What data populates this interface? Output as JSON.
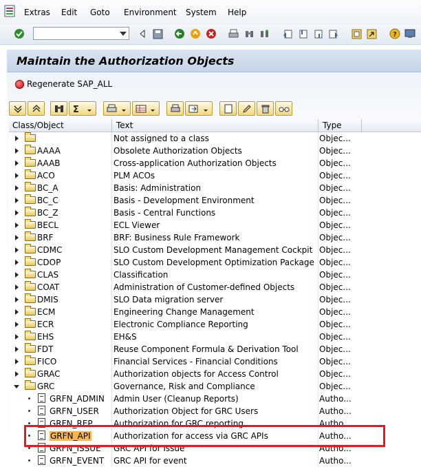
{
  "menu": [
    "Extras",
    "Edit",
    "Goto",
    "Environment",
    "System",
    "Help"
  ],
  "title": "Maintain the Authorization Objects",
  "regenerate_label": "Regenerate SAP_ALL",
  "columns": [
    "Class/Object",
    "Text",
    "Type"
  ],
  "rows": [
    {
      "name": "",
      "text": "Not assigned to a class",
      "type": "Objec..."
    },
    {
      "name": "AAAA",
      "text": "Obsolete Authorization Objects",
      "type": "Objec..."
    },
    {
      "name": "AAAB",
      "text": "Cross-application Authorization Objects",
      "type": "Objec..."
    },
    {
      "name": "ACO",
      "text": "PLM ACOs",
      "type": "Objec..."
    },
    {
      "name": "BC_A",
      "text": "Basis: Administration",
      "type": "Objec..."
    },
    {
      "name": "BC_C",
      "text": "Basis - Development Environment",
      "type": "Objec..."
    },
    {
      "name": "BC_Z",
      "text": "Basis - Central Functions",
      "type": "Objec..."
    },
    {
      "name": "BECL",
      "text": "ECL Viewer",
      "type": "Objec..."
    },
    {
      "name": "BRF",
      "text": "BRF: Business Rule Framework",
      "type": "Objec..."
    },
    {
      "name": "CDMC",
      "text": "SLO Custom Development Management Cockpit",
      "type": "Objec..."
    },
    {
      "name": "CDOP",
      "text": "SLO Custom Development Optimization Package",
      "type": "Objec..."
    },
    {
      "name": "CLAS",
      "text": "Classification",
      "type": "Objec..."
    },
    {
      "name": "COAT",
      "text": "Administration of Customer-defined Objects",
      "type": "Objec..."
    },
    {
      "name": "DMIS",
      "text": "SLO Data migration server",
      "type": "Objec..."
    },
    {
      "name": "ECM",
      "text": "Engineering Change Management",
      "type": "Objec..."
    },
    {
      "name": "ECR",
      "text": "Electronic Compliance Reporting",
      "type": "Objec..."
    },
    {
      "name": "EHS",
      "text": "EH&S",
      "type": "Objec..."
    },
    {
      "name": "FDT",
      "text": "Reuse Component Formula & Derivation Tool",
      "type": "Objec..."
    },
    {
      "name": "FICO",
      "text": "Financial Services - Financial Conditions",
      "type": "Objec..."
    },
    {
      "name": "GRAC",
      "text": "Authorization objects for Access Control",
      "type": "Objec..."
    },
    {
      "name": "GRC",
      "text": "Governance, Risk and Compliance",
      "type": "Objec..."
    }
  ],
  "sub_rows": [
    {
      "name": "GRFN_ADMIN",
      "text": "Admin User (Cleanup Reports)",
      "type": "Autho..."
    },
    {
      "name": "GRFN_USER",
      "text": "Authorization Object for GRC Users",
      "type": "Autho..."
    },
    {
      "name": "GRFN_REP",
      "text": "Authorization for GRC reporting",
      "type": "Autho..."
    },
    {
      "name": "GRFN_API",
      "text": "Authorization for access via GRC APIs",
      "type": "Autho..."
    },
    {
      "name": "GRFN_ISSUE",
      "text": "GRC API for Issue",
      "type": "Autho..."
    },
    {
      "name": "GRFN_EVENT",
      "text": "GRC API for event",
      "type": "Autho..."
    }
  ],
  "selected_object": "GRFN_API",
  "colors": {
    "highlight_border": "#e01b22",
    "selection": "#f7b54a"
  }
}
